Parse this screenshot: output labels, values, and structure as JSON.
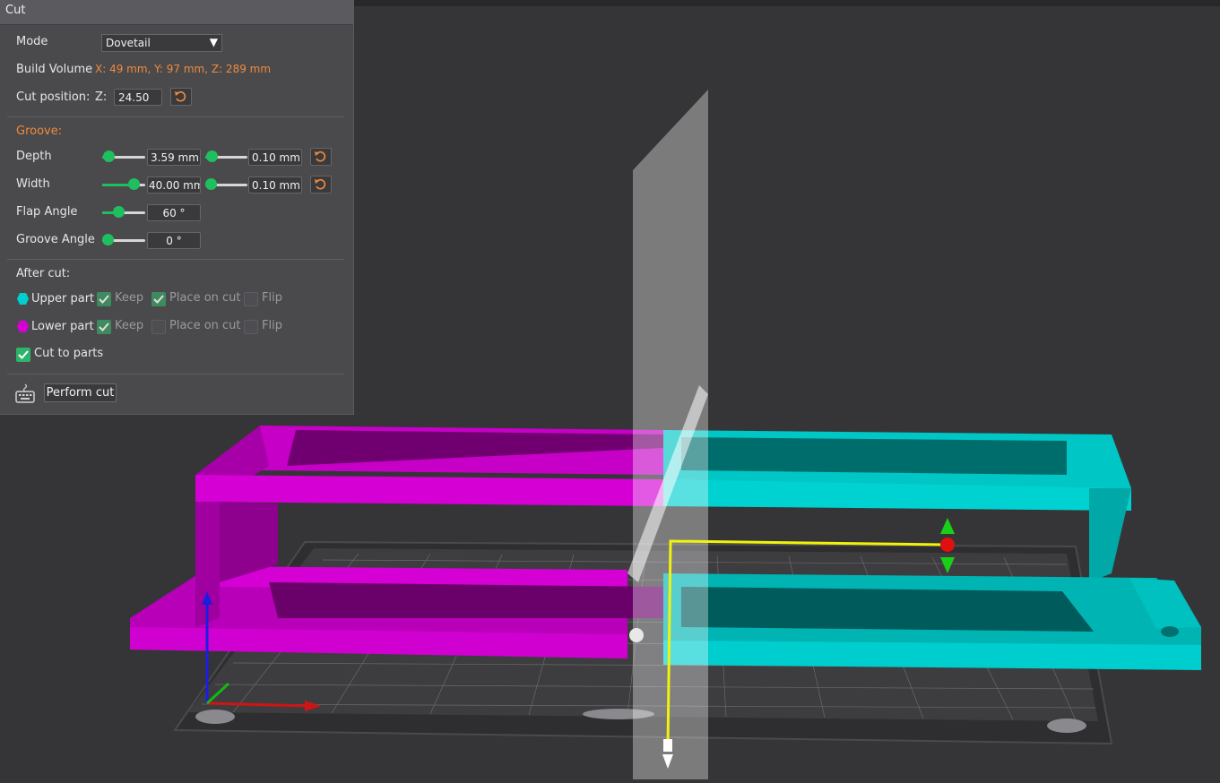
{
  "panel": {
    "title": "Cut",
    "mode_label": "Mode",
    "mode_value": "Dovetail",
    "build_volume_label": "Build Volume",
    "build_volume_value": "X: 49 mm,  Y: 97 mm,  Z: 289 mm",
    "cut_position_label": "Cut position:",
    "cut_axis": "Z:",
    "cut_value": "24.50",
    "groove_heading": "Groove:",
    "rows": {
      "depth": {
        "label": "Depth",
        "value1": "3.59  mm",
        "value2": "0.10  mm",
        "level1": 0.1,
        "level2": 0.1
      },
      "width": {
        "label": "Width",
        "value1": "40.00  mm",
        "value2": "0.10  mm",
        "level1": 0.7,
        "level2": 0.05
      },
      "flap_angle": {
        "label": "Flap Angle",
        "value1": "60 °",
        "level1": 0.3
      },
      "groove_angle": {
        "label": "Groove Angle",
        "value1": "0 °",
        "level1": 0.0
      }
    },
    "after_cut_heading": "After cut:",
    "upper_part_label": "Upper part",
    "lower_part_label": "Lower part",
    "keep_label": "Keep",
    "place_on_cut_label": "Place on cut",
    "flip_label": "Flip",
    "upper_keep": true,
    "upper_place_on_cut": true,
    "upper_flip": false,
    "lower_keep": true,
    "lower_place_on_cut": false,
    "lower_flip": false,
    "cut_to_parts_label": "Cut to parts",
    "cut_to_parts": true,
    "perform_cut_label": "Perform cut"
  },
  "colors": {
    "accent": "#f08a3c",
    "upper_part": "#00cfcf",
    "lower_part": "#d400d4",
    "slider": "#1fbf5f"
  },
  "icons": {
    "reset": "reset-icon",
    "keyboard": "keyboard-icon",
    "dropdown": "chevron-down-icon"
  }
}
